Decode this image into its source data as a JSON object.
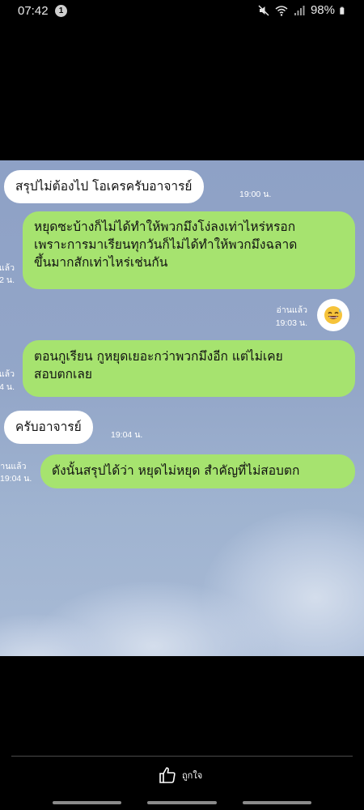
{
  "status_bar": {
    "time": "07:42",
    "notification_count": "1",
    "battery": "98%"
  },
  "chat": {
    "messages": [
      {
        "side": "in",
        "text": "สรุปไม่ต้องไป โอเครครับอาจารย์",
        "time": "19:00 น."
      },
      {
        "side": "out",
        "lines": [
          "หยุดซะบ้างก็ไม่ได้ทำให้พวกมึงโง่ลงเท่าไหร่หรอก",
          "เพราะการมาเรียนทุกวันก็ไม่ได้ทำให้พวกมึงฉลาด",
          "ขึ้นมากสักเท่าไหร่เช่นกัน"
        ],
        "read_partial": "แล้ว",
        "time_partial": "2 น."
      },
      {
        "side": "out",
        "sticker": "grinning-sweat-emoji",
        "read": "อ่านแล้ว",
        "time": "19:03 น."
      },
      {
        "side": "out",
        "lines": [
          "ตอนกูเรียน กูหยุดเยอะกว่าพวกมึงอีก แต่ไม่เคย",
          "สอบตกเลย"
        ],
        "read_partial": "แล้ว",
        "time_partial": "4 น."
      },
      {
        "side": "in",
        "text": "ครับอาจารย์",
        "time": "19:04 น."
      },
      {
        "side": "out",
        "text": "ดังนั้นสรุปได้ว่า หยุดไม่หยุด สำคัญที่ไม่สอบตก",
        "read_partial": "อ่านแล้ว",
        "time_partial": "19:04 น."
      }
    ]
  },
  "bottom_bar": {
    "like_label": "ถูกใจ"
  },
  "colors": {
    "incoming_bubble": "#ffffff",
    "outgoing_bubble": "#a6e36f",
    "chat_background": "#93a6c8"
  }
}
